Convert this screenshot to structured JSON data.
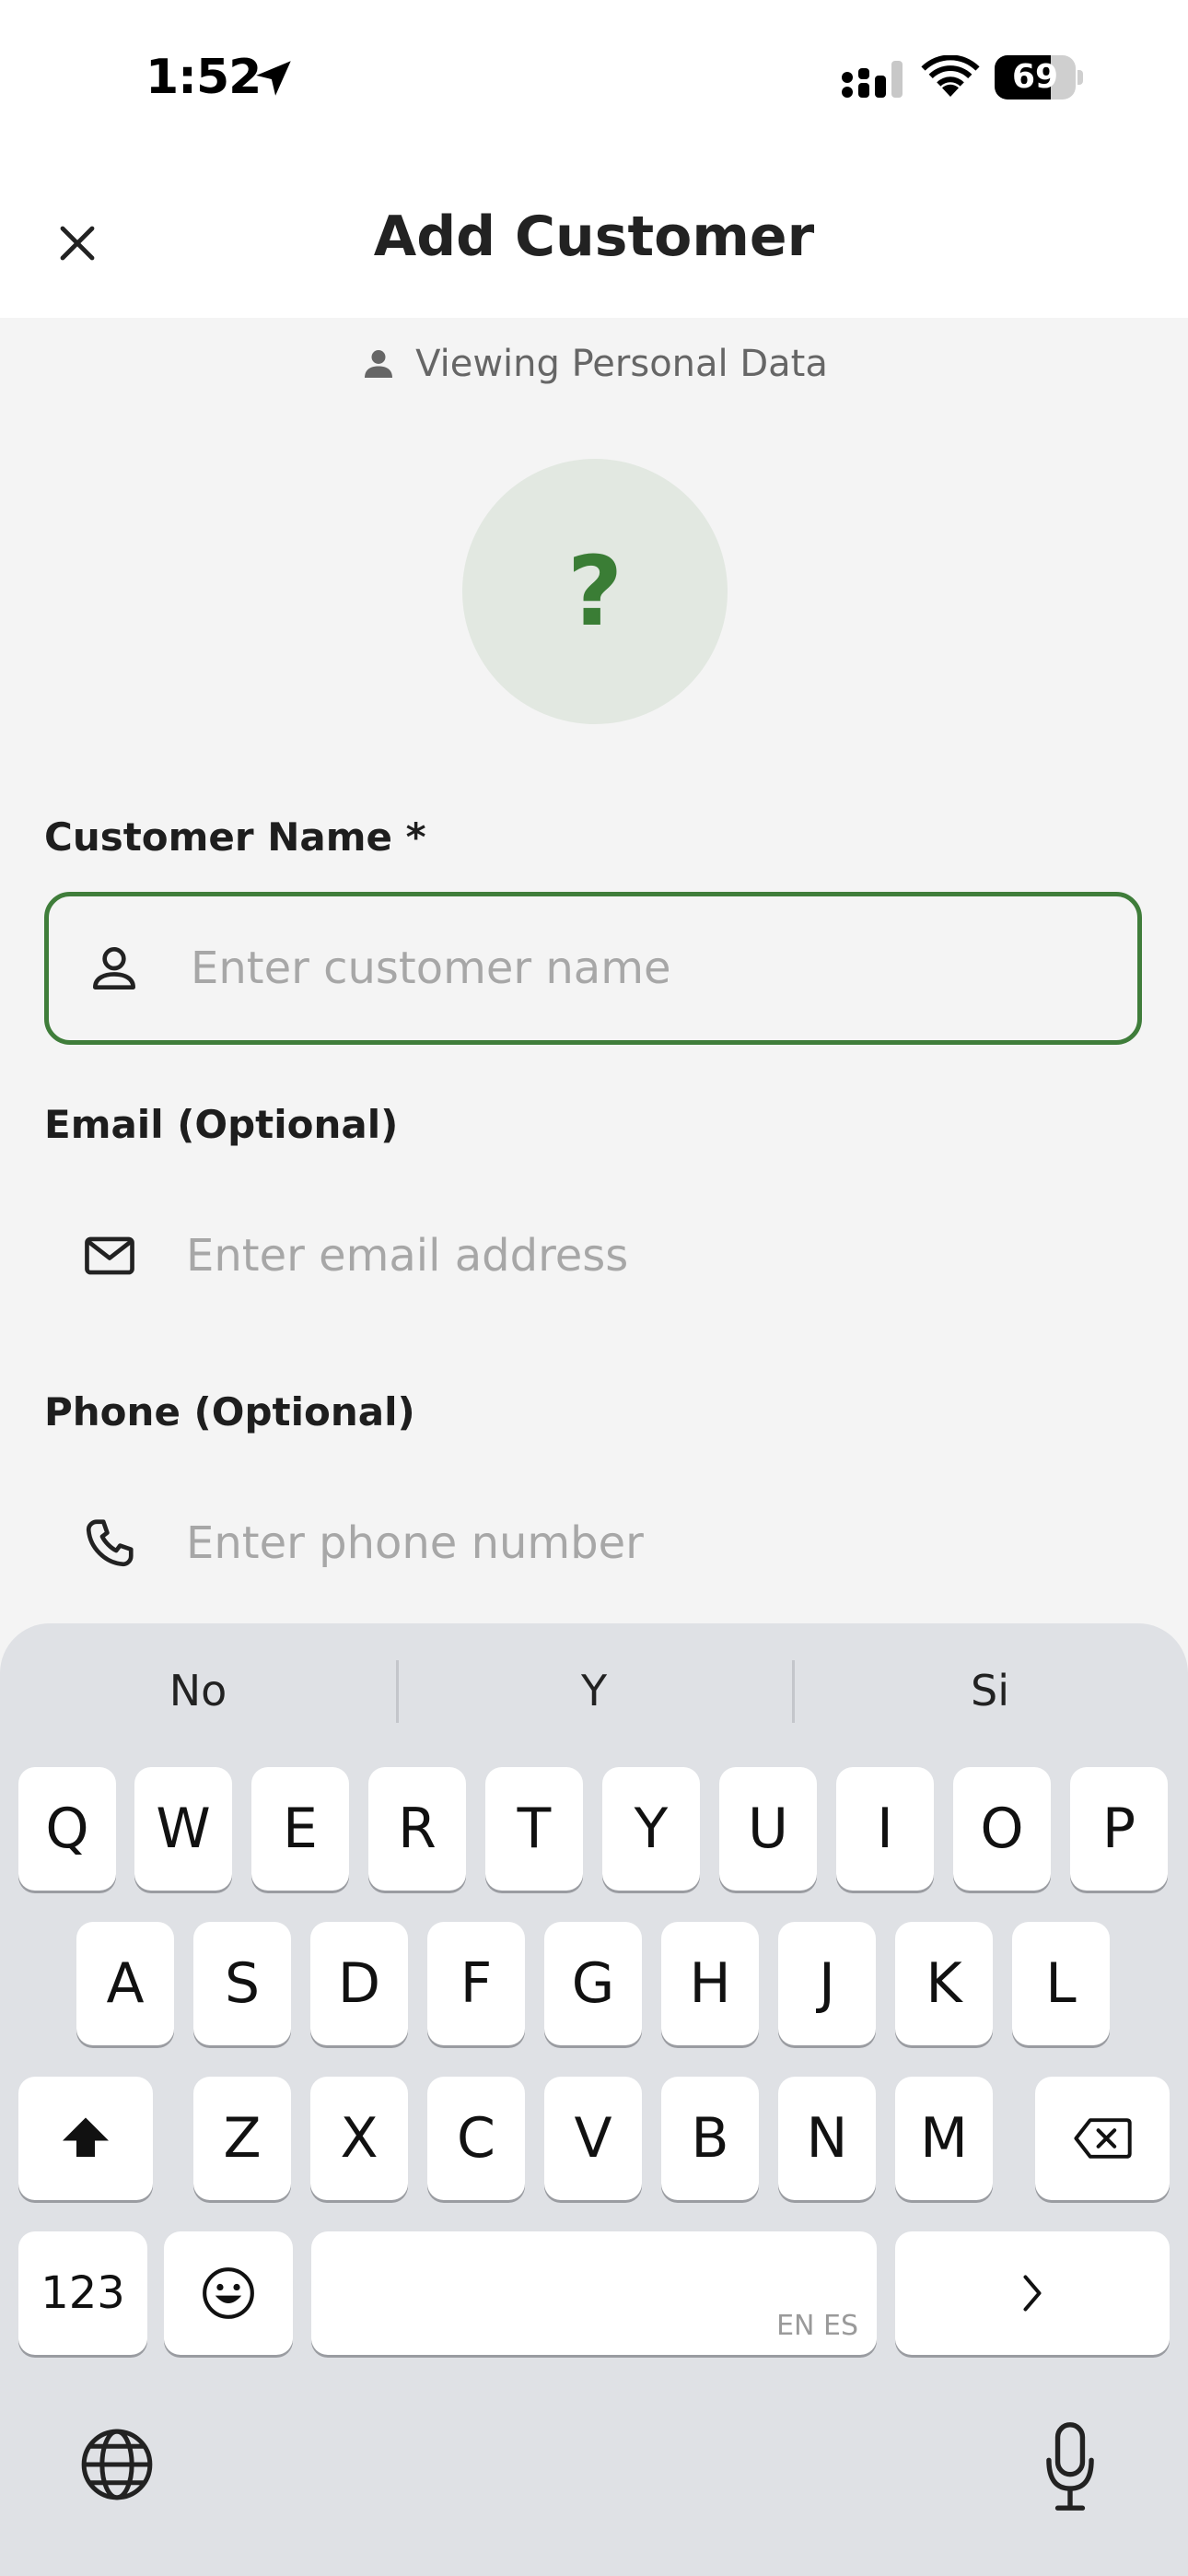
{
  "status_bar": {
    "time": "1:52",
    "battery_level": "69",
    "battery_fraction": 0.69,
    "icons": [
      "location-arrow-icon",
      "cellular-signal-icon",
      "wifi-icon",
      "battery-icon"
    ]
  },
  "header": {
    "title": "Add Customer",
    "close_icon": "close-icon"
  },
  "privacy_notice": {
    "icon": "person-icon",
    "text": "Viewing Personal Data"
  },
  "avatar": {
    "placeholder": "?"
  },
  "form": {
    "name": {
      "label": "Customer Name *",
      "placeholder": "Enter customer name",
      "value": "",
      "icon": "person-outline-icon"
    },
    "email": {
      "label": "Email (Optional)",
      "placeholder": "Enter email address",
      "value": "",
      "icon": "mail-icon"
    },
    "phone": {
      "label": "Phone (Optional)",
      "placeholder": "Enter phone number",
      "value": "",
      "icon": "phone-icon"
    }
  },
  "keyboard": {
    "suggestions": [
      "No",
      "Y",
      "Si"
    ],
    "row1": [
      "Q",
      "W",
      "E",
      "R",
      "T",
      "Y",
      "U",
      "I",
      "O",
      "P"
    ],
    "row2": [
      "A",
      "S",
      "D",
      "F",
      "G",
      "H",
      "J",
      "K",
      "L"
    ],
    "row3": [
      "Z",
      "X",
      "C",
      "V",
      "B",
      "N",
      "M"
    ],
    "numbers_label": "123",
    "space_language_tag": "EN ES",
    "icons": [
      "shift-icon",
      "backspace-icon",
      "emoji-icon",
      "next-field-icon",
      "globe-icon",
      "microphone-icon"
    ]
  },
  "colors": {
    "accent": "#3f7d3a",
    "avatar_background": "#e2e8e1",
    "page_background": "#f4f4f4",
    "keyboard_background": "#dfe1e5"
  }
}
